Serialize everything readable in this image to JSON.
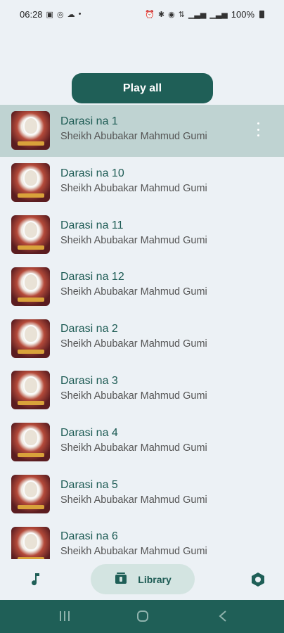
{
  "status_bar": {
    "time": "06:28",
    "battery_text": "100%"
  },
  "play_all_label": "Play all",
  "tracks": [
    {
      "title": "Darasi na 1",
      "artist": "Sheikh Abubakar Mahmud Gumi",
      "selected": true
    },
    {
      "title": "Darasi na 10",
      "artist": "Sheikh Abubakar Mahmud Gumi"
    },
    {
      "title": "Darasi na 11",
      "artist": "Sheikh Abubakar Mahmud Gumi"
    },
    {
      "title": "Darasi na 12",
      "artist": "Sheikh Abubakar Mahmud Gumi"
    },
    {
      "title": "Darasi na 2",
      "artist": "Sheikh Abubakar Mahmud Gumi"
    },
    {
      "title": "Darasi na 3",
      "artist": "Sheikh Abubakar Mahmud Gumi"
    },
    {
      "title": "Darasi na 4",
      "artist": "Sheikh Abubakar Mahmud Gumi"
    },
    {
      "title": "Darasi na 5",
      "artist": "Sheikh Abubakar Mahmud Gumi"
    },
    {
      "title": "Darasi na 6",
      "artist": "Sheikh Abubakar Mahmud Gumi"
    }
  ],
  "bottom_nav": {
    "music_icon": "music-note-icon",
    "library_label": "Library",
    "library_icon": "library-icon",
    "settings_icon": "settings-icon"
  },
  "colors": {
    "accent": "#1f5f57",
    "selected_row": "#bfd3d2",
    "background": "#ecf1f5"
  }
}
